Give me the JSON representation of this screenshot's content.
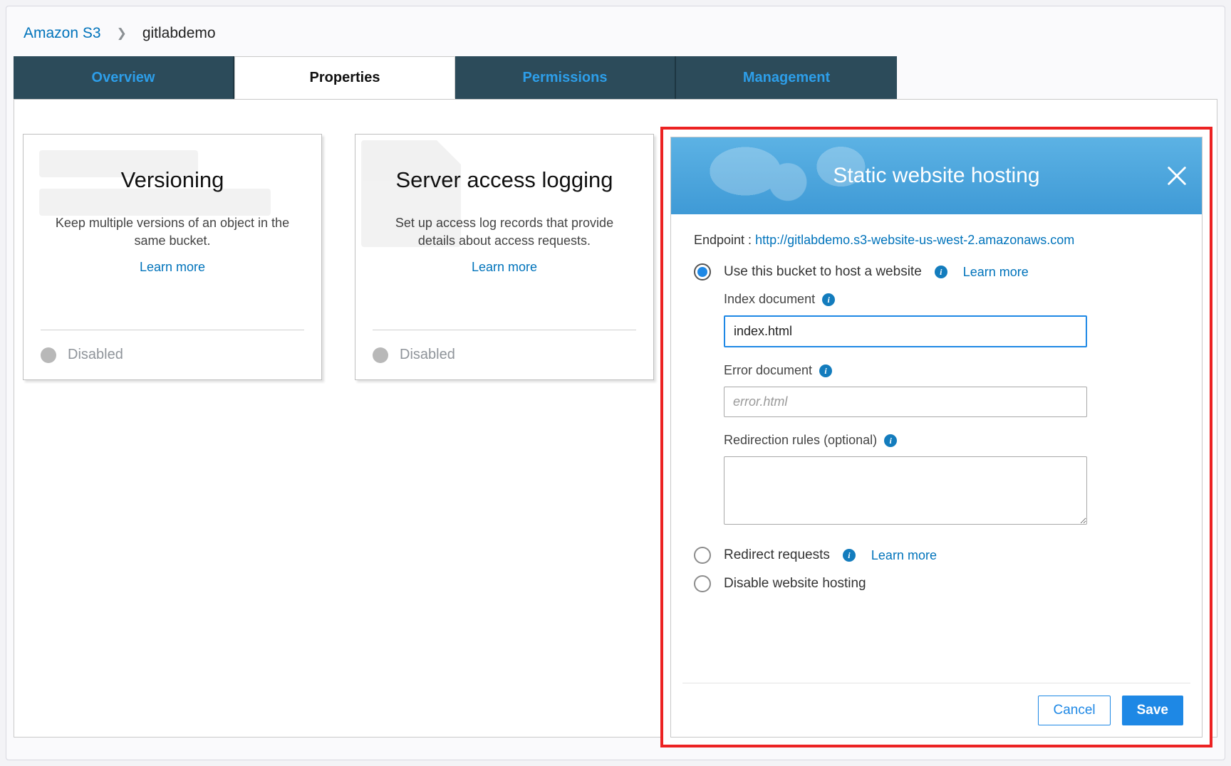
{
  "breadcrumb": {
    "root": "Amazon S3",
    "current": "gitlabdemo"
  },
  "tabs": {
    "overview": "Overview",
    "properties": "Properties",
    "permissions": "Permissions",
    "management": "Management"
  },
  "cards": {
    "versioning": {
      "title": "Versioning",
      "desc": "Keep multiple versions of an object in the same bucket.",
      "learn": "Learn more",
      "status": "Disabled"
    },
    "logging": {
      "title": "Server access logging",
      "desc": "Set up access log records that provide details about access requests.",
      "learn": "Learn more",
      "status": "Disabled"
    }
  },
  "panel": {
    "title": "Static website hosting",
    "endpoint_label": "Endpoint : ",
    "endpoint_url": "http://gitlabdemo.s3-website-us-west-2.amazonaws.com",
    "opt_host": "Use this bucket to host a website",
    "opt_host_learn": "Learn more",
    "index_label": "Index document",
    "index_value": "index.html",
    "error_label": "Error document",
    "error_placeholder": "error.html",
    "redir_label": "Redirection rules (optional)",
    "opt_redirect": "Redirect requests",
    "opt_redirect_learn": "Learn more",
    "opt_disable": "Disable website hosting",
    "cancel": "Cancel",
    "save": "Save"
  }
}
